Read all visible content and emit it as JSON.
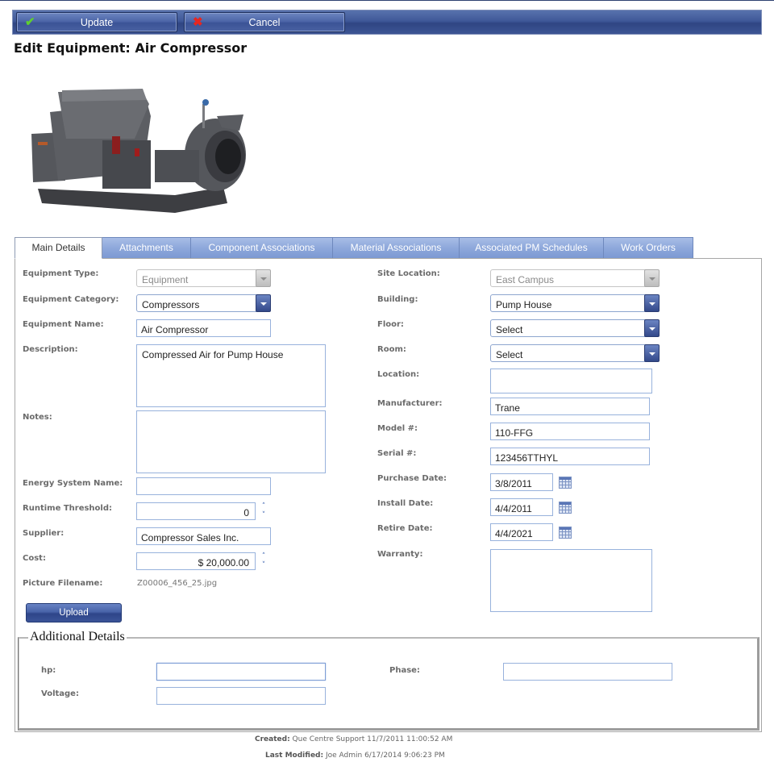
{
  "toolbar": {
    "update_label": "Update",
    "cancel_label": "Cancel",
    "update_icon": "checkmark-icon",
    "cancel_icon": "x-icon"
  },
  "page": {
    "title": "Edit Equipment: Air Compressor",
    "photo_alt": "Air compressor equipment photo"
  },
  "tabs": [
    {
      "label": "Main Details",
      "active": true
    },
    {
      "label": "Attachments",
      "active": false
    },
    {
      "label": "Component Associations",
      "active": false
    },
    {
      "label": "Material Associations",
      "active": false
    },
    {
      "label": "Associated PM Schedules",
      "active": false
    },
    {
      "label": "Work Orders",
      "active": false
    }
  ],
  "left": {
    "equipment_type": {
      "label": "Equipment Type:",
      "value": "Equipment"
    },
    "equipment_category": {
      "label": "Equipment Category:",
      "value": "Compressors"
    },
    "equipment_name": {
      "label": "Equipment Name:",
      "value": "Air Compressor"
    },
    "description": {
      "label": "Description:",
      "value": "Compressed Air for Pump House"
    },
    "notes": {
      "label": "Notes:",
      "value": ""
    },
    "energy_system_name": {
      "label": "Energy System Name:",
      "value": ""
    },
    "runtime_threshold": {
      "label": "Runtime Threshold:",
      "value": "0"
    },
    "supplier": {
      "label": "Supplier:",
      "value": "Compressor Sales Inc."
    },
    "cost": {
      "label": "Cost:",
      "value": "$ 20,000.00"
    },
    "picture_filename": {
      "label": "Picture Filename:",
      "value": "Z00006_456_25.jpg"
    },
    "upload_label": "Upload"
  },
  "right": {
    "site_location": {
      "label": "Site Location:",
      "value": "East Campus"
    },
    "building": {
      "label": "Building:",
      "value": "Pump House"
    },
    "floor": {
      "label": "Floor:",
      "value": "Select"
    },
    "room": {
      "label": "Room:",
      "value": "Select"
    },
    "location": {
      "label": "Location:",
      "value": ""
    },
    "manufacturer": {
      "label": "Manufacturer:",
      "value": "Trane"
    },
    "model": {
      "label": "Model #:",
      "value": "110-FFG"
    },
    "serial": {
      "label": "Serial #:",
      "value": "123456TTHYL"
    },
    "purchase_date": {
      "label": "Purchase Date:",
      "value": "3/8/2011"
    },
    "install_date": {
      "label": "Install Date:",
      "value": "4/4/2011"
    },
    "retire_date": {
      "label": "Retire Date:",
      "value": "4/4/2021"
    },
    "warranty": {
      "label": "Warranty:",
      "value": ""
    }
  },
  "additional": {
    "legend": "Additional Details",
    "hp": {
      "label": "hp:",
      "value": ""
    },
    "voltage": {
      "label": "Voltage:",
      "value": ""
    },
    "phase": {
      "label": "Phase:",
      "value": ""
    }
  },
  "footer": {
    "created_label": "Created:",
    "created_value": "Que Centre Support 11/7/2011 11:00:52 AM",
    "modified_label": "Last Modified:",
    "modified_value": "Joe Admin 6/17/2014 9:06:23 PM"
  }
}
